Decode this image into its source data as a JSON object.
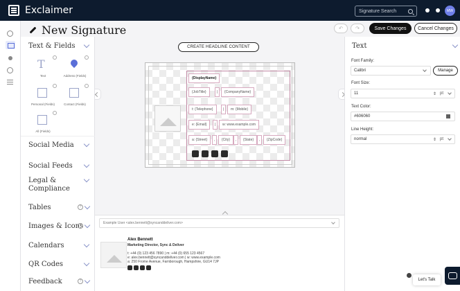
{
  "app": {
    "brand": "Exclaimer"
  },
  "header": {
    "search_placeholder": "Signature Search",
    "avatar_initials": "MW"
  },
  "page": {
    "title": "New Signature",
    "save_label": "Save Changes",
    "cancel_label": "Cancel Changes"
  },
  "sidebar": {
    "sections": {
      "text_fields": "Text & Fields",
      "social_media": "Social Media",
      "social_feeds": "Social Feeds",
      "legal": "Legal & Compliance",
      "tables": "Tables",
      "images_icons": "Images & Icons",
      "calendars": "Calendars",
      "qr_codes": "QR Codes",
      "feedback": "Feedback"
    },
    "tiles": {
      "text": "Text",
      "address": "Address (Fields)",
      "personal": "Personal (Fields)",
      "contact": "Contact (Fields)",
      "all": "All (Fields)"
    }
  },
  "canvas": {
    "headline_button": "CREATE HEADLINE CONTENT",
    "fields": {
      "display_name": "{DisplayName}",
      "job_title": "{JobTitle}",
      "sep": "|",
      "company": "{CompanyName}",
      "telephone": "t: {Telephone}",
      "mobile": "m: {Mobile}",
      "email": "e: {Email}",
      "web": "w: www.example.com",
      "street": "a: {Street}",
      "comma": ",",
      "city": "{City}",
      "state": "{State}",
      "zip": "{ZipCode}"
    }
  },
  "preview": {
    "example_user": "Example User <alex.bennett@syncanddeliver.com>",
    "name": "Alex Bennett",
    "role": "Marketing Director, Sync & Deliver",
    "line1": "t: +44 (0) 123 456 7890 | m: +44 (0) 655 123 4567",
    "line2": "e: alex.bennett@syncanddeliver.com | w: www.example.com",
    "line3": "a: 250 Frome Avenue, Farnborough, Hampshire, GU14 7JP"
  },
  "properties": {
    "title": "Text",
    "font_family_label": "Font Family:",
    "font_family_value": "Calibri",
    "manage_label": "Manage",
    "font_size_label": "Font Size:",
    "font_size_value": "11",
    "font_size_unit": "pt",
    "text_color_label": "Text Color:",
    "text_color_value": "#606060",
    "line_height_label": "Line Height:",
    "line_height_value": "normal",
    "line_height_unit": "pt"
  },
  "chat": {
    "lets_talk": "Let's Talk"
  }
}
